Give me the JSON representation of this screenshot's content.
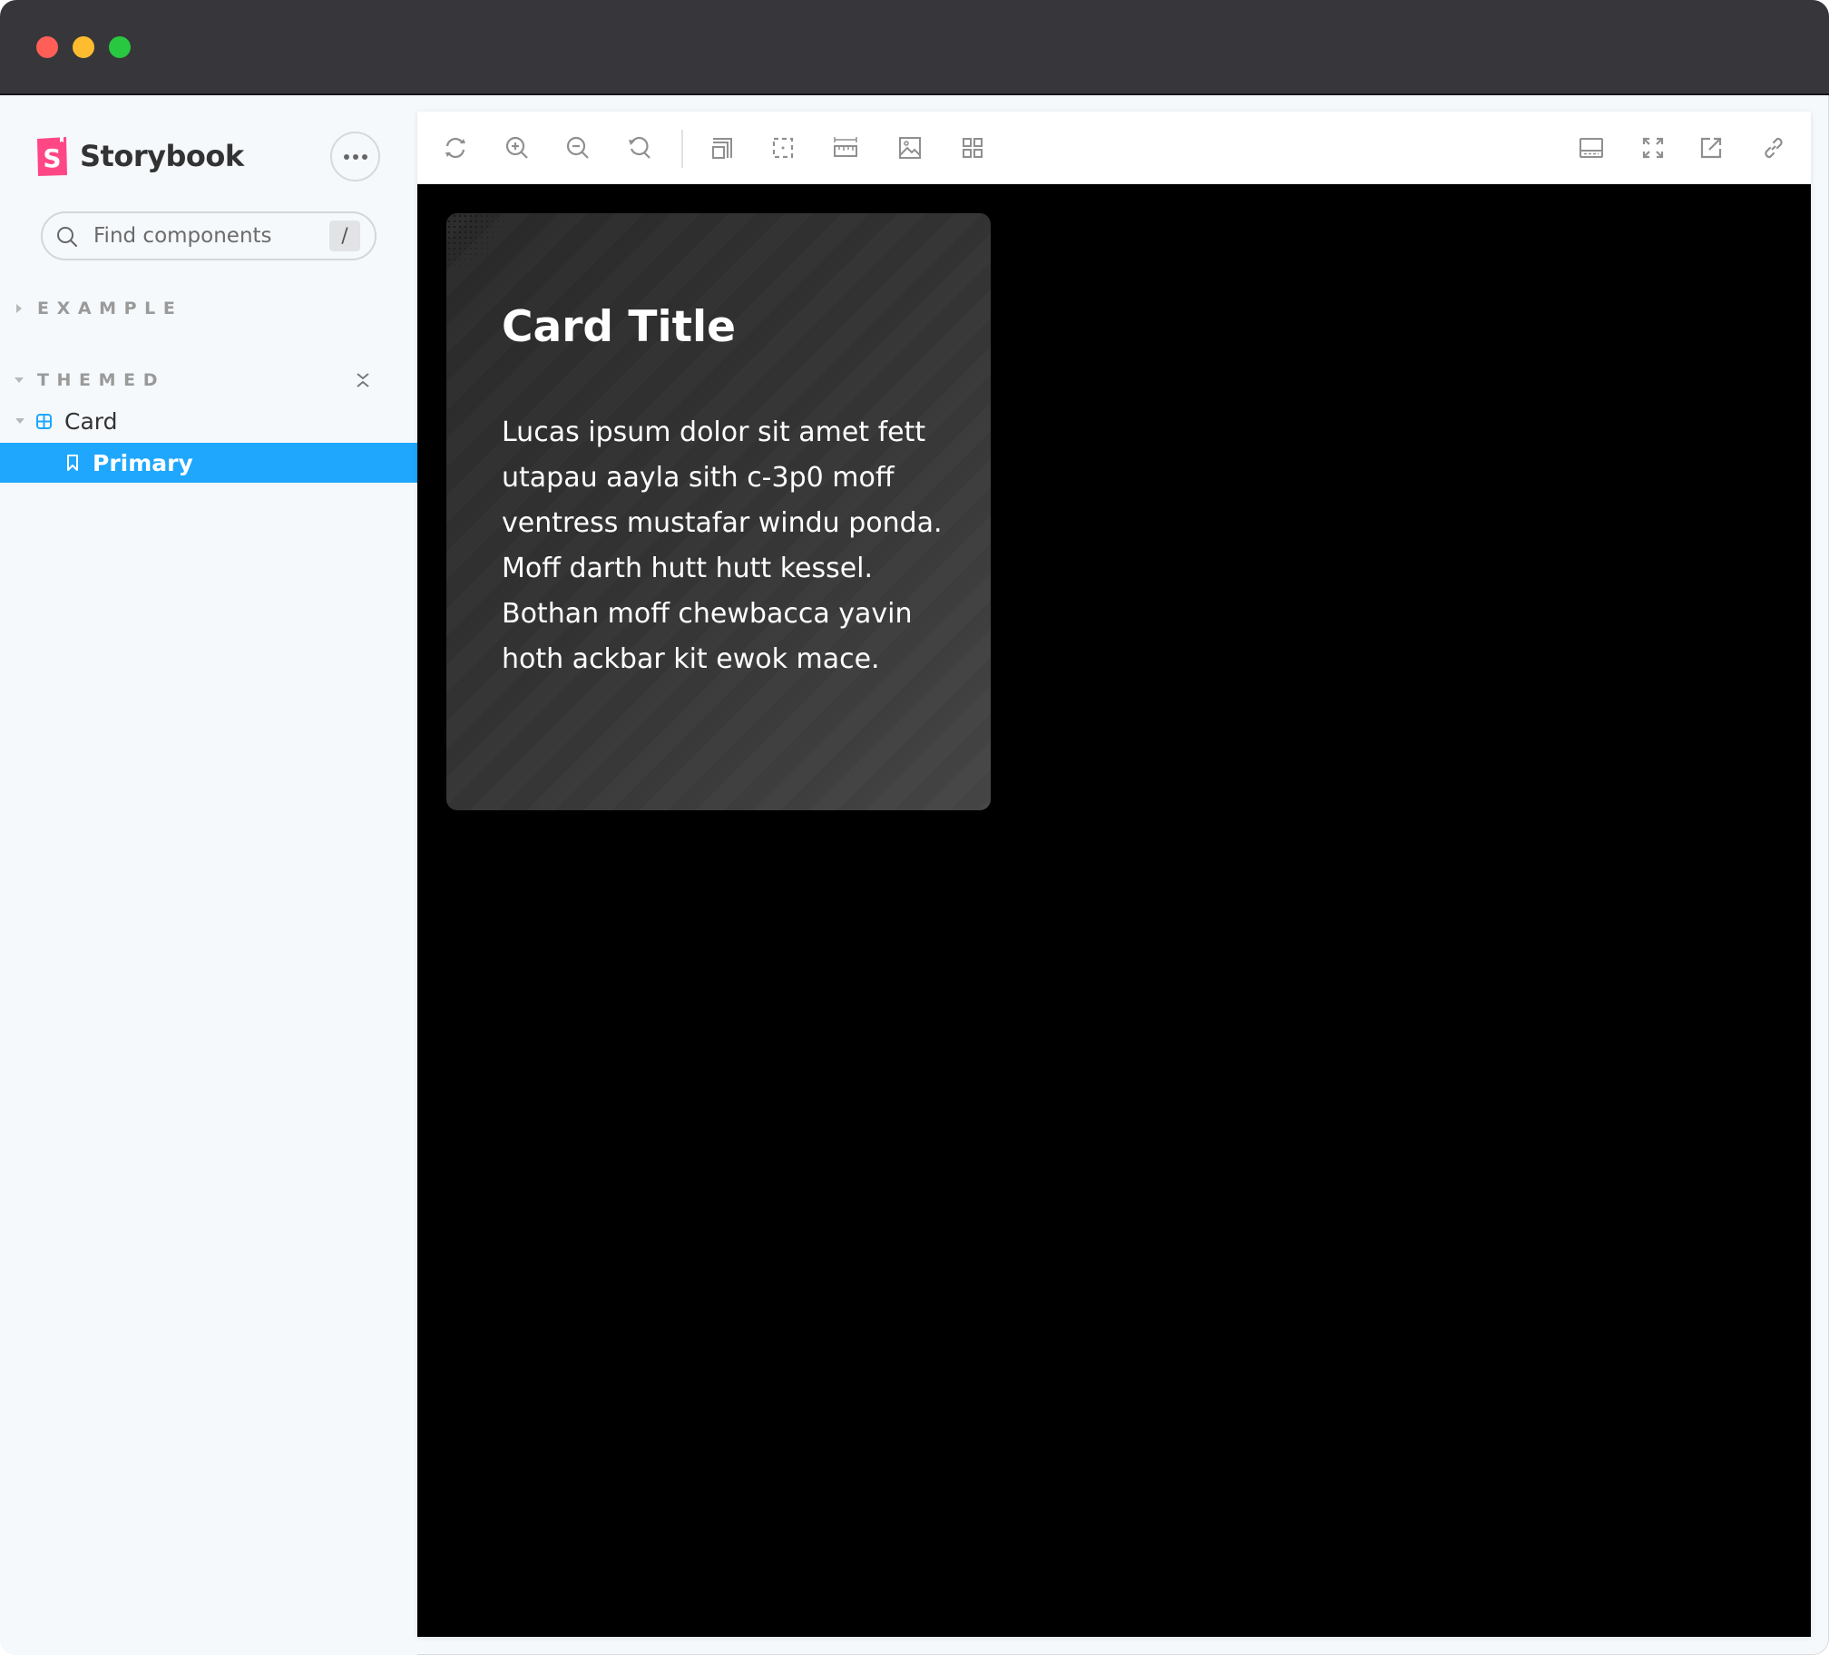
{
  "window": {
    "traffic_lights": [
      {
        "name": "close",
        "color": "#FF5F57"
      },
      {
        "name": "minimize",
        "color": "#FEBC2E"
      },
      {
        "name": "zoom",
        "color": "#28C840"
      }
    ]
  },
  "sidebar": {
    "brand": {
      "name": "Storybook",
      "logo_letter": "S",
      "logo_color": "#FF4785"
    },
    "menu_button_label": "•••",
    "search": {
      "placeholder": "Find components",
      "value": "",
      "shortcut": "/"
    },
    "groups": [
      {
        "label": "EXAMPLE",
        "expanded": false
      },
      {
        "label": "THEMED",
        "expanded": true
      }
    ],
    "components": [
      {
        "label": "Card",
        "expanded": true,
        "stories": [
          {
            "label": "Primary",
            "selected": true
          }
        ]
      }
    ],
    "selected_color": "#1EA7FD"
  },
  "toolbar": {
    "left_tools": [
      {
        "icon": "refresh-icon",
        "label": "Reload story"
      },
      {
        "icon": "zoom-in-icon",
        "label": "Zoom in"
      },
      {
        "icon": "zoom-out-icon",
        "label": "Zoom out"
      },
      {
        "icon": "zoom-reset-icon",
        "label": "Reset zoom"
      },
      {
        "icon": "outline-icon",
        "label": "Toggle outline"
      },
      {
        "icon": "measure-icon",
        "label": "Measure"
      },
      {
        "icon": "ruler-icon",
        "label": "Viewport"
      },
      {
        "icon": "background-image-icon",
        "label": "Change background"
      },
      {
        "icon": "grid-icon",
        "label": "Apply grid"
      }
    ],
    "right_tools": [
      {
        "icon": "panel-icon",
        "label": "Show addons"
      },
      {
        "icon": "fullscreen-icon",
        "label": "Go full screen"
      },
      {
        "icon": "open-new-tab-icon",
        "label": "Open canvas in new tab"
      },
      {
        "icon": "link-icon",
        "label": "Copy canvas link"
      }
    ]
  },
  "preview": {
    "background": "#000000",
    "card": {
      "title": "Card Title",
      "body": "Lucas ipsum dolor sit amet fett utapau aayla sith c-3p0 moff ventress mustafar windu ponda. Moff darth hutt hutt kessel. Bothan moff chewbacca yavin hoth ackbar kit ewok mace."
    }
  }
}
